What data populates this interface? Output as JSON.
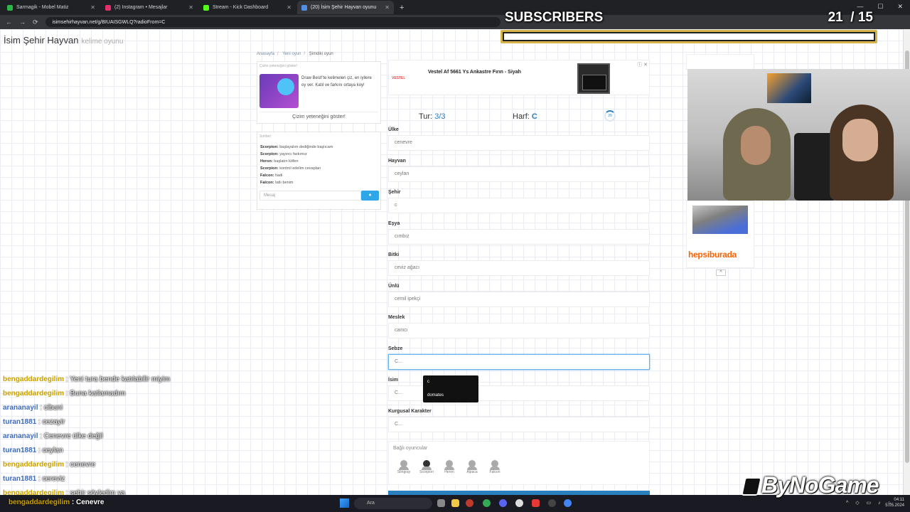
{
  "browser": {
    "tabs": [
      {
        "label": "Sarmagik - Mobel Matiz",
        "color": "#2fb84a"
      },
      {
        "label": "(2) Instagram • Mesajlar",
        "color": "#e1306c"
      },
      {
        "label": "Stream - Kick Dashboard",
        "color": "#53fc18"
      },
      {
        "label": "(20) İsim Şehir Hayvan oyunu",
        "color": "#4f8fe8"
      }
    ],
    "url": "isimsehirhayvan.net/g/BIUAISGWLQ?radioFrom=C"
  },
  "site": {
    "brand": "İsim Şehir Hayvan",
    "brand_sub": "kelime oyunu",
    "breadcrumb": [
      "Anasayfa",
      "Yeni oyun",
      "Şimdiki oyun"
    ]
  },
  "promo": {
    "header": "Çizim yeteneğini göster!",
    "text": "Draw Best!'te kelimeleri çiz, en iyilere oy ver. Katıl ve farkını ortaya koy!",
    "button": "Çizim yeteneğini göster!"
  },
  "chat": {
    "header": "Sohbet",
    "messages": [
      {
        "user": "Scorpion:",
        "text": "başlayalım dediğinde başlıcam"
      },
      {
        "user": "Scorpion:",
        "text": "yayıncı farkımız"
      },
      {
        "user": "Heron:",
        "text": "başlatın lütfen"
      },
      {
        "user": "Scorpion:",
        "text": "kontrol edelim cevapları"
      },
      {
        "user": "Falcon:",
        "text": "hadi"
      },
      {
        "user": "Falcon:",
        "text": "tatlı benim"
      }
    ],
    "input_placeholder": "Mesaj",
    "send_icon": "chat-bubble-icon"
  },
  "ad": {
    "brand": "VESTEL",
    "title": "Vestel Af 5661 Ys Ankastre Fırın - Siyah"
  },
  "game": {
    "tur_label": "Tur:",
    "tur_value": "3/3",
    "harf_label": "Harf:",
    "harf_value": "C",
    "timer": "20",
    "fields": [
      {
        "label": "Ülke",
        "value": "cenevre"
      },
      {
        "label": "Hayvan",
        "value": "ceylan"
      },
      {
        "label": "Şehir",
        "value": "c"
      },
      {
        "label": "Eşya",
        "value": "cımbız"
      },
      {
        "label": "Bitki",
        "value": "ceviz ağacı"
      },
      {
        "label": "Ünlü",
        "value": "cemil ipekçi"
      },
      {
        "label": "Meslek",
        "value": "camcı"
      },
      {
        "label": "Sebze",
        "value": "C..."
      },
      {
        "label": "İsim",
        "value": "C..."
      },
      {
        "label": "Kurgusal Karakter",
        "value": "C..."
      }
    ],
    "tooltip": {
      "line1": "c",
      "line2": "domates"
    },
    "players_header": "Bağlı oyuncular",
    "players": [
      "Stingray",
      "Scorpion",
      "Heron",
      "Alpaca",
      "Falcon"
    ]
  },
  "side_ad": {
    "brand": "hepsiburada"
  },
  "overlay": {
    "subs_title": "SUBSCRIBERS",
    "subs_current": "21",
    "subs_goal": "15",
    "subs_progress": 1.0,
    "logo": "ByNoGame",
    "stream_chat": [
      {
        "user": "bengaddardegilim",
        "msg": "Yeni tura bende katılabilir miyim",
        "color": "gold"
      },
      {
        "user": "bengaddardegilim",
        "msg": "Buna katlamadım",
        "color": "gold"
      },
      {
        "user": "arananayil",
        "msg": "cibuni",
        "color": "blue"
      },
      {
        "user": "turan1881",
        "msg": "cezayir",
        "color": "blue"
      },
      {
        "user": "arananayil",
        "msg": "Cenevre ülke değil",
        "color": "blue"
      },
      {
        "user": "turan1881",
        "msg": "ceylan",
        "color": "blue"
      },
      {
        "user": "bengaddardegilim",
        "msg": "cenevre",
        "color": "gold"
      },
      {
        "user": "turan1881",
        "msg": "cereviz",
        "color": "blue"
      },
      {
        "user": "bengaddardegilim",
        "msg": "şehir söyledim ya",
        "color": "gold"
      }
    ],
    "taskbar_chat": {
      "user": "bengaddardegilim",
      "msg": "Cenevre"
    }
  },
  "taskbar": {
    "search_placeholder": "Ara",
    "time": "04:11",
    "date": "5.05.2024"
  }
}
